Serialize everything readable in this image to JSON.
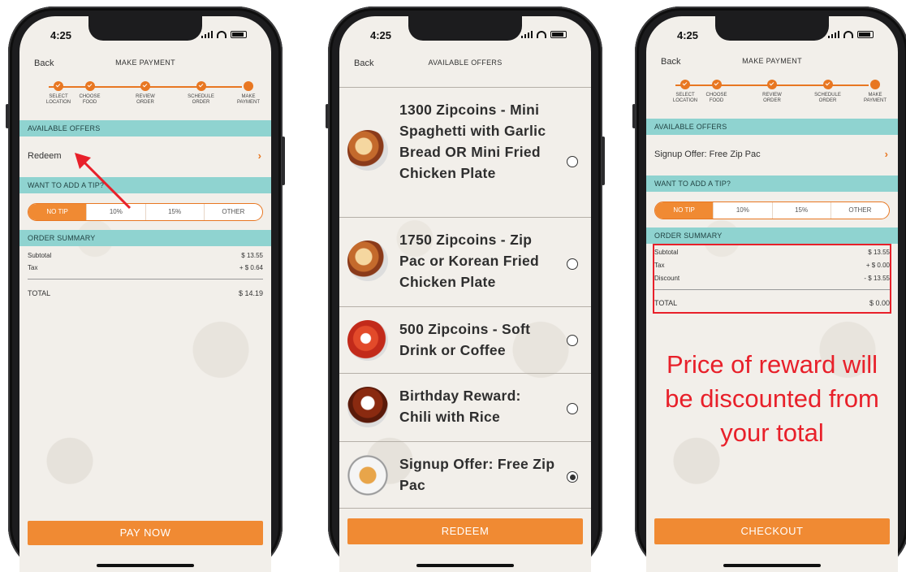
{
  "status_time": "4:25",
  "phone1": {
    "back": "Back",
    "title": "MAKE PAYMENT",
    "steps": [
      "SELECT\nLOCATION",
      "CHOOSE\nFOOD",
      "REVIEW\nORDER",
      "SCHEDULE\nORDER",
      "MAKE\nPAYMENT"
    ],
    "offers_head": "AVAILABLE OFFERS",
    "offer_row": "Redeem",
    "tip_head": "WANT TO ADD A TIP?",
    "tips": [
      "NO TIP",
      "10%",
      "15%",
      "OTHER"
    ],
    "summary_head": "ORDER SUMMARY",
    "subtotal_label": "Subtotal",
    "subtotal_value": "$ 13.55",
    "tax_label": "Tax",
    "tax_value": "+ $ 0.64",
    "total_label": "TOTAL",
    "total_value": "$ 14.19",
    "cta": "PAY NOW"
  },
  "phone2": {
    "back": "Back",
    "title": "AVAILABLE OFFERS",
    "offers": [
      {
        "title": "1300 Zipcoins - Mini Spaghetti with Garlic Bread OR Mini Fried Chicken Plate",
        "selected": false
      },
      {
        "title": "1750 Zipcoins - Zip Pac or Korean Fried Chicken Plate",
        "selected": false
      },
      {
        "title": "500 Zipcoins - Soft Drink or Coffee",
        "selected": false
      },
      {
        "title": "Birthday Reward: Chili with Rice",
        "selected": false
      },
      {
        "title": "Signup Offer: Free Zip Pac",
        "selected": true
      }
    ],
    "cta": "REDEEM"
  },
  "phone3": {
    "back": "Back",
    "title": "MAKE PAYMENT",
    "steps": [
      "SELECT\nLOCATION",
      "CHOOSE\nFOOD",
      "REVIEW\nORDER",
      "SCHEDULE\nORDER",
      "MAKE\nPAYMENT"
    ],
    "offers_head": "AVAILABLE OFFERS",
    "offer_row": "Signup Offer: Free Zip Pac",
    "tip_head": "WANT TO ADD A TIP?",
    "tips": [
      "NO TIP",
      "10%",
      "15%",
      "OTHER"
    ],
    "summary_head": "ORDER SUMMARY",
    "subtotal_label": "Subtotal",
    "subtotal_value": "$ 13.55",
    "tax_label": "Tax",
    "tax_value": "+ $ 0.00",
    "discount_label": "Discount",
    "discount_value": "- $ 13.55",
    "total_label": "TOTAL",
    "total_value": "$ 0.00",
    "cta": "CHECKOUT",
    "note": "Price of reward will be discounted from your total"
  },
  "colors": {
    "accent_orange": "#f08a33",
    "section_teal": "#8fd3d0",
    "annotation_red": "#e8202a"
  }
}
